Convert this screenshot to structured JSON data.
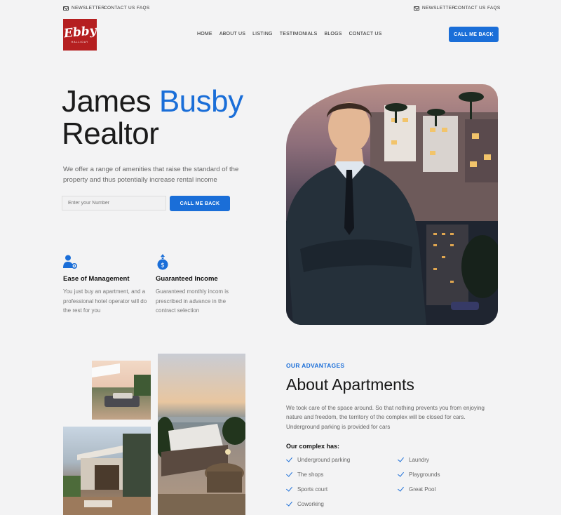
{
  "topbar": {
    "left": {
      "newsletter": "Newsletter",
      "contact": "Contact Us",
      "faqs": "FAQs"
    },
    "right": {
      "newsletter": "Newsletter",
      "contact": "Contact Us",
      "faqs": "FAQs"
    }
  },
  "logo": {
    "word": "Ebby",
    "sub": "HALLIDAY"
  },
  "nav": [
    "Home",
    "About Us",
    "Listing",
    "Testimonials",
    "Blogs",
    "Contact Us"
  ],
  "header_cta": "Call Me Back",
  "hero": {
    "title_first": "James",
    "title_blue": "Busby",
    "title_second": "Realtor",
    "description": "We offer a range of amenities that raise the standard of the property and thus potentially increase rental income",
    "input_placeholder": "Enter your Number",
    "cta": "Call Me Back"
  },
  "features": [
    {
      "icon": "user-gear-icon",
      "title": "Ease of Management",
      "text": "You just buy an apartment, and a professional hotel operator will do the rest for you"
    },
    {
      "icon": "money-bag-icon",
      "title": "Guaranteed Income",
      "text": "Guaranteed monthly incom is prescribed in advance in the contract selection"
    }
  ],
  "about": {
    "label": "Our Advantages",
    "title": "About Apartments",
    "text": "We took care of the space around. So that nothing prevents you from enjoying nature and freedom, the territory of the complex will be closed for cars. Underground parking is provided for cars",
    "complex_title": "Our complex has:",
    "left_list": [
      "Underground parking",
      "The shops",
      "Sports court",
      "Coworking"
    ],
    "right_list": [
      "Laundry",
      "Playgrounds",
      "Great Pool"
    ]
  },
  "colors": {
    "accent": "#1a6ed8",
    "brand_red": "#b51f20",
    "background": "#f3f3f4"
  }
}
